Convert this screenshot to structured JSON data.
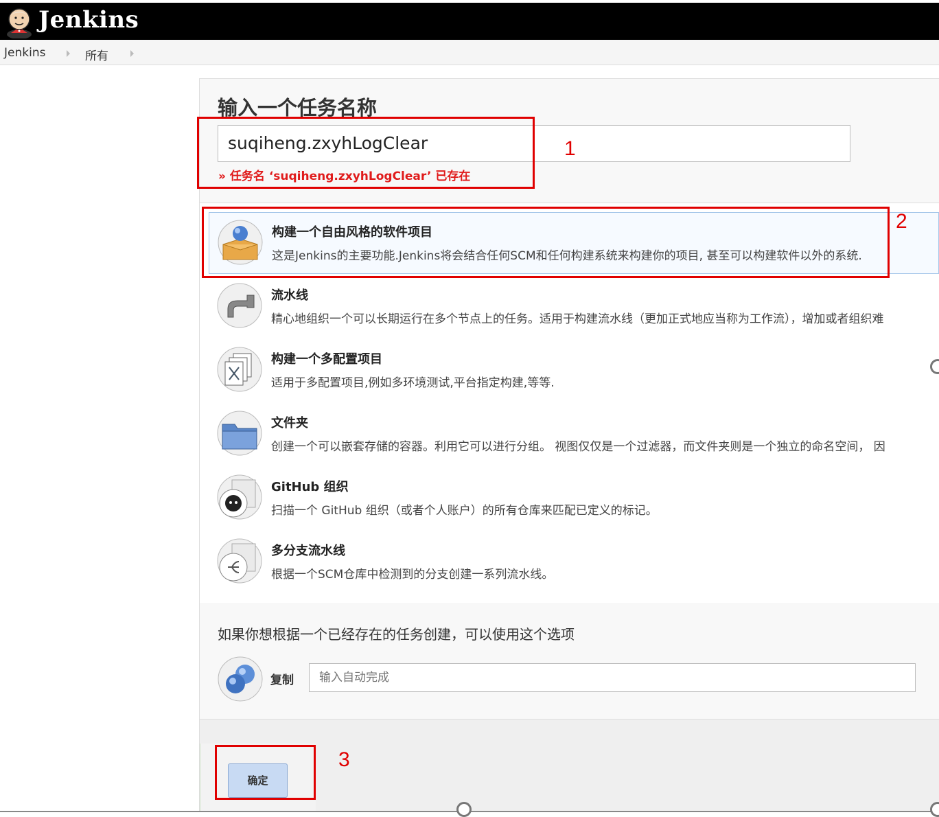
{
  "header": {
    "brand": "Jenkins"
  },
  "breadcrumb": {
    "items": [
      {
        "label": "Jenkins"
      },
      {
        "label": "所有"
      }
    ]
  },
  "form": {
    "title": "输入一个任务名称",
    "name_value": "suqiheng.zxyhLogClear",
    "error": "» 任务名 ‘suqiheng.zxyhLogClear’ 已存在"
  },
  "item_types": [
    {
      "title": "构建一个自由风格的软件项目",
      "desc": "这是Jenkins的主要功能.Jenkins将会结合任何SCM和任何构建系统来构建你的项目, 甚至可以构建软件以外的系统.",
      "icon": "freestyle-box-icon",
      "selected": true
    },
    {
      "title": "流水线",
      "desc": "精心地组织一个可以长期运行在多个节点上的任务。适用于构建流水线（更加正式地应当称为工作流），增加或者组织难",
      "icon": "pipeline-icon"
    },
    {
      "title": "构建一个多配置项目",
      "desc": "适用于多配置项目,例如多环境测试,平台指定构建,等等.",
      "icon": "multi-config-icon"
    },
    {
      "title": "文件夹",
      "desc": "创建一个可以嵌套存储的容器。利用它可以进行分组。 视图仅仅是一个过滤器，而文件夹则是一个独立的命名空间， 因",
      "icon": "folder-icon"
    },
    {
      "title": "GitHub 组织",
      "desc": "扫描一个 GitHub 组织（或者个人账户）的所有仓库来匹配已定义的标记。",
      "icon": "github-org-icon"
    },
    {
      "title": "多分支流水线",
      "desc": "根据一个SCM仓库中检测到的分支创建一系列流水线。",
      "icon": "multibranch-icon"
    }
  ],
  "copy": {
    "hint": "如果你想根据一个已经存在的任务创建，可以使用这个选项",
    "label": "复制",
    "placeholder": "输入自动完成"
  },
  "ok_button": "确定",
  "annotations": [
    "1",
    "2",
    "3"
  ],
  "colors": {
    "annotation": "#e00000",
    "error": "#e01b1b",
    "header": "#000000"
  }
}
